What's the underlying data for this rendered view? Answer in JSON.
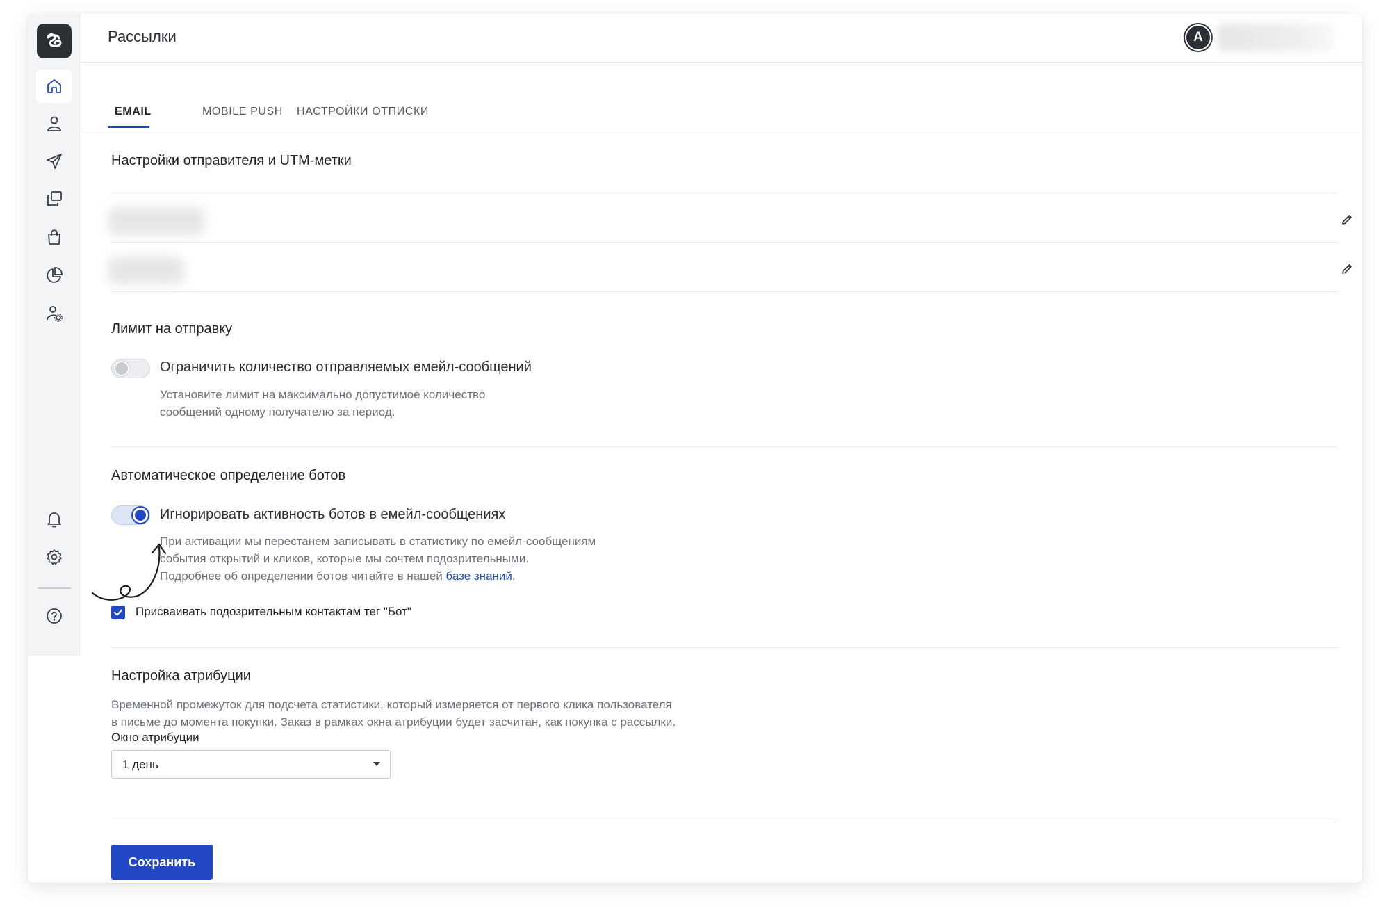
{
  "header": {
    "title": "Рассылки",
    "avatar_letter": "A"
  },
  "sidebar": {
    "items": [
      {
        "icon": "home-icon",
        "active": true
      },
      {
        "icon": "user-icon"
      },
      {
        "icon": "send-icon"
      },
      {
        "icon": "copy-icon"
      },
      {
        "icon": "shopping-bag-icon"
      },
      {
        "icon": "pie-chart-icon"
      },
      {
        "icon": "user-settings-icon"
      },
      {
        "icon": "bell-icon"
      },
      {
        "icon": "gear-icon"
      },
      {
        "icon": "help-icon"
      }
    ]
  },
  "tabs": [
    {
      "label": "EMAIL",
      "active": true
    },
    {
      "label": "MOBILE PUSH"
    },
    {
      "label": "НАСТРОЙКИ ОТПИСКИ"
    }
  ],
  "sender": {
    "title": "Настройки отправителя и UTM-метки"
  },
  "limit": {
    "title": "Лимит на отправку",
    "toggle_label": "Ограничить количество отправляемых емейл-сообщений",
    "toggle_on": false,
    "hint_line1": "Установите лимит на максимально допустимое количество",
    "hint_line2": "сообщений одному получателю за период."
  },
  "bots": {
    "title": "Автоматическое определение ботов",
    "toggle_label": "Игнорировать активность ботов в емейл-сообщениях",
    "toggle_on": true,
    "hint_line1": "При активации мы перестанем записывать в статистику по емейл-сообщениям",
    "hint_line2": "события открытий и кликов, которые мы сочтем подозрительными.",
    "hint_line3_prefix": "Подробнее об определении ботов читайте в нашей ",
    "hint_link": "базе знаний",
    "hint_line3_suffix": ".",
    "checkbox_label": "Присваивать подозрительным контактам тег \"Бот\"",
    "checkbox_checked": true
  },
  "attribution": {
    "title": "Настройка атрибуции",
    "desc_line1": "Временной промежуток для подсчета статистики, который измеряется от первого клика пользователя",
    "desc_line2": "в письме до момента покупки. Заказ в рамках окна атрибуции будет засчитан, как покупка с рассылки.",
    "window_label": "Окно атрибуции",
    "window_value": "1 день"
  },
  "actions": {
    "save_label": "Сохранить"
  },
  "colors": {
    "accent": "#2147c4",
    "sidebar_bg": "#f3f4f6"
  }
}
